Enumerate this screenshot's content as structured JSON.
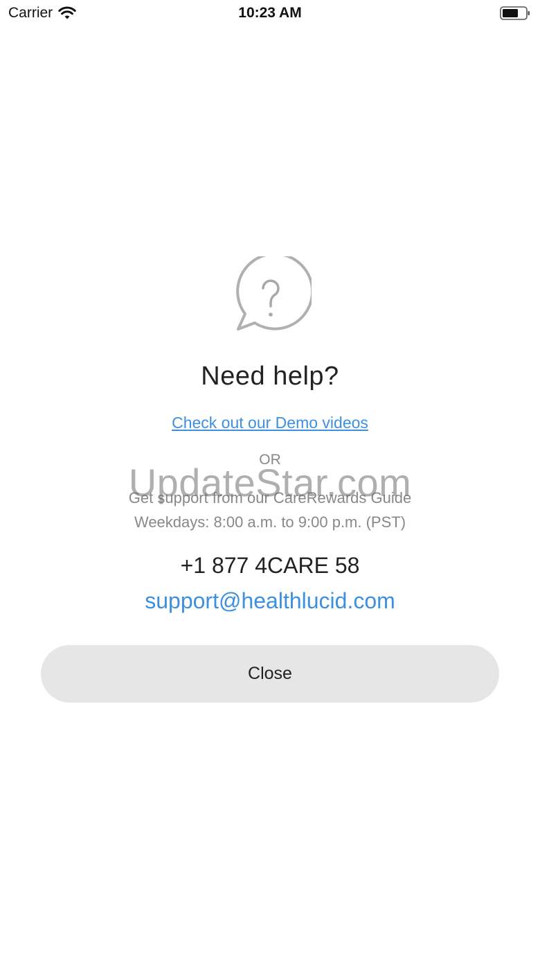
{
  "status_bar": {
    "carrier": "Carrier",
    "time": "10:23 AM",
    "icons": [
      "wifi-icon",
      "battery-icon"
    ]
  },
  "help": {
    "icon": "question-speech-bubble-icon",
    "title": "Need help?",
    "demo_link": "Check out our Demo videos",
    "or_text": "OR",
    "support_line_1": "Get support from our CareRewards Guide",
    "support_line_2": "Weekdays: 8:00 a.m. to 9:00 p.m. (PST)",
    "phone": "+1 877 4CARE 58",
    "email": "support@healthlucid.com",
    "close_label": "Close"
  },
  "watermark": {
    "text": "UpdateStar.com"
  },
  "colors": {
    "link": "#3d8fe0",
    "button_bg": "#e6e6e6",
    "muted_text": "#888888",
    "primary_text": "#222222"
  }
}
